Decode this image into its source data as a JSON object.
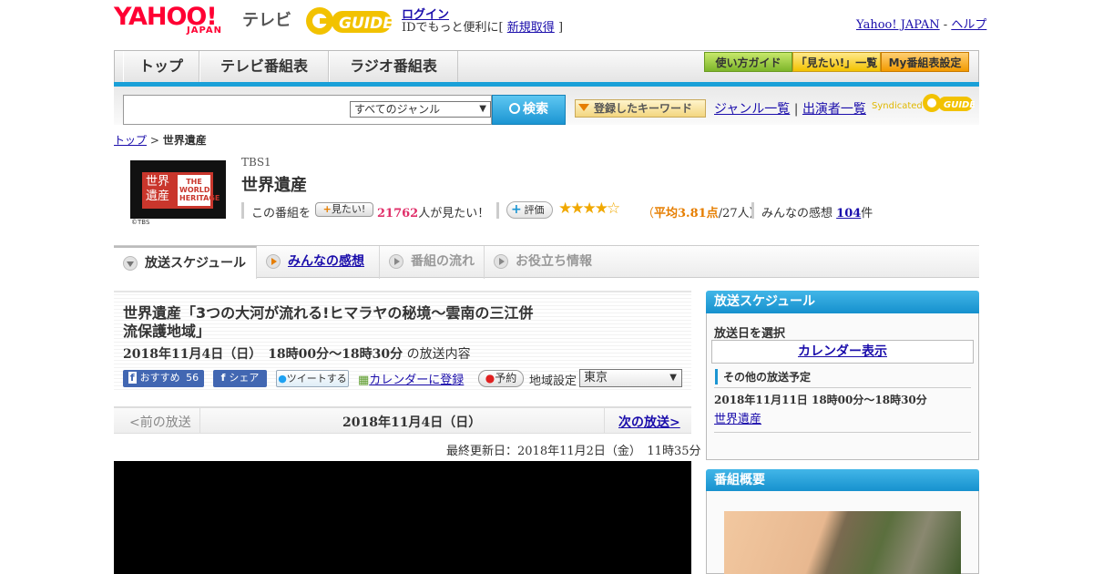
{
  "header": {
    "logo_yahoo": "YAHOO!",
    "logo_japan": "JAPAN",
    "logo_tv": "テレビ",
    "logo_gguide": "GUIDE",
    "login": "ログイン",
    "login_note_prefix": "IDでもっと便利に[",
    "login_note_link": "新規取得",
    "login_note_suffix": "]",
    "yahoo_japan_link": "Yahoo! JAPAN",
    "separator": "-",
    "help_link": "ヘルプ"
  },
  "nav": {
    "tabs": [
      "トップ",
      "テレビ番組表",
      "ラジオ番組表"
    ],
    "buttons": [
      "使い方ガイド",
      "「見たい!」一覧",
      "My番組表設定"
    ]
  },
  "search": {
    "genre_select": "すべてのジャンル",
    "button": "検索",
    "keyword_button": "登録したキーワード",
    "genre_list_link": "ジャンル一覧",
    "divider": "|",
    "cast_list_link": "出演者一覧",
    "syndicated": "Syndicated"
  },
  "breadcrumb": {
    "top": "トップ",
    "sep": ">",
    "current": "世界遺産"
  },
  "program": {
    "thumb_jp": "世界遺産",
    "thumb_en": "THE WORLD HERITAGE",
    "thumb_credit": "©TBS",
    "channel": "TBS1",
    "title": "世界遺産",
    "want_prefix": "この番組を",
    "mitai_button": "見たい!",
    "want_count": "21762",
    "want_suffix": "人が見たい！",
    "eval_button": "評価",
    "stars": "★★★★☆",
    "rating_open": "（",
    "rating_avg": "平均3.81点",
    "rating_tail": "/27人）",
    "kansou_label": "みんなの感想",
    "kansou_count": "104",
    "kansou_suffix": "件"
  },
  "tabs": [
    "放送スケジュール",
    "みんなの感想",
    "番組の流れ",
    "お役立ち情報"
  ],
  "episode": {
    "title": "世界遺産「3つの大河が流れる!ヒマラヤの秘境～雲南の三江併流保護地域」",
    "datetime": "2018年11月4日（日）　18時00分～18時30分",
    "datetime_suffix": "の放送内容",
    "fb_recommend": "おすすめ",
    "fb_count": "56",
    "fb_share": "シェア",
    "tweet": "ツイートする",
    "calendar": "カレンダーに登録",
    "reserve": "予約",
    "area_label": "地域設定",
    "area_value": "東京"
  },
  "pagenav": {
    "prev": "<前の放送",
    "date": "2018年11月4日（日）",
    "next": "次の放送>"
  },
  "updated": "最終更新日：2018年11月2日（金）　11時35分",
  "sidebar": {
    "schedule_head": "放送スケジュール",
    "date_label": "放送日を選択",
    "calendar_button": "カレンダー表示",
    "other_label": "その他の放送予定",
    "other_date": "2018年11月11日  18時00分～18時30分",
    "other_link": "世界遺産",
    "overview_head": "番組概要"
  },
  "colors": {
    "accent_blue": "#1b95d2",
    "yahoo_red": "#ff0033",
    "want_pink": "#e0306a",
    "rating_orange": "#e67e00"
  }
}
